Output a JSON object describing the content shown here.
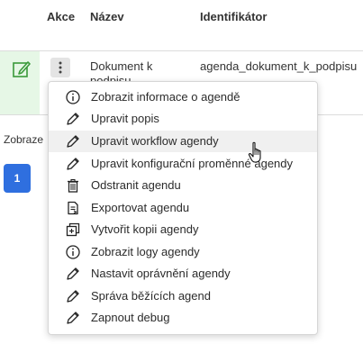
{
  "table": {
    "columns": {
      "akce": "Akce",
      "nazev": "Název",
      "identifikator": "Identifikátor"
    },
    "row": {
      "name": "Dokument k podpisu",
      "identifier": "agenda_dokument_k_podpisu"
    }
  },
  "footer": {
    "display_text": "Zobraze",
    "page": "1"
  },
  "menu": {
    "items": [
      {
        "label": "Zobrazit informace o agendě",
        "icon": "info-icon"
      },
      {
        "label": "Upravit popis",
        "icon": "pencil-icon"
      },
      {
        "label": "Upravit workflow agendy",
        "icon": "pencil-icon"
      },
      {
        "label": "Upravit konfigurační proměnné agendy",
        "icon": "pencil-icon"
      },
      {
        "label": "Odstranit agendu",
        "icon": "trash-icon"
      },
      {
        "label": "Exportovat agendu",
        "icon": "export-icon"
      },
      {
        "label": "Vytvořit kopii agendy",
        "icon": "copy-icon"
      },
      {
        "label": "Zobrazit logy agendy",
        "icon": "info-icon"
      },
      {
        "label": "Nastavit oprávnění agendy",
        "icon": "pencil-icon"
      },
      {
        "label": "Správa běžících agend",
        "icon": "pencil-icon"
      },
      {
        "label": "Zapnout debug",
        "icon": "pencil-icon"
      }
    ]
  },
  "colors": {
    "accent": "#2f6fdf",
    "row_highlight": "#e6f7e6",
    "edit_icon": "#3a9a3a"
  }
}
